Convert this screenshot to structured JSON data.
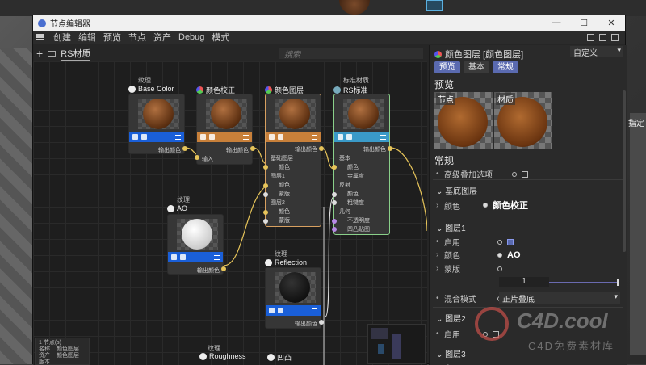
{
  "window": {
    "title": "节点编辑器",
    "controls": [
      "—",
      "☐",
      "✕"
    ]
  },
  "menu": [
    "创建",
    "编辑",
    "预览",
    "节点",
    "资产",
    "Debug",
    "模式"
  ],
  "editor": {
    "tab": "RS材质",
    "search_placeholder": "搜索"
  },
  "nodes": {
    "base_color": {
      "group": "纹理",
      "title": "Base Color",
      "port_out": "输出颜色"
    },
    "color_correct": {
      "title": "颜色校正",
      "port_in": "输入",
      "port_out": "输出颜色"
    },
    "color_layer": {
      "title": "颜色图层",
      "port_out": "输出颜色",
      "ports": [
        "基础图层",
        "颜色",
        "图层1",
        "颜色",
        "蒙版",
        "图层2",
        "颜色",
        "蒙版"
      ]
    },
    "rs_standard": {
      "group": "标准材质",
      "title": "RS标准",
      "port_out": "输出颜色",
      "ports": [
        "基本",
        "颜色",
        "金属度",
        "反射",
        "颜色",
        "粗糙度",
        "几何",
        "不透明度",
        "凹凸贴图"
      ]
    },
    "ao": {
      "group": "纹理",
      "title": "AO",
      "port_out": "输出颜色"
    },
    "reflection": {
      "group": "纹理",
      "title": "Reflection",
      "port_out": "输出颜色"
    },
    "roughness": {
      "group": "纹理",
      "title": "Roughness"
    },
    "bump": {
      "title": "凹凸"
    }
  },
  "info": {
    "count": "1 节点(s)",
    "rows": [
      [
        "名称",
        "颜色图层"
      ],
      [
        "资产",
        "颜色图层"
      ],
      [
        "版本",
        ""
      ]
    ]
  },
  "panel": {
    "header": "颜色图层 [颜色图层]",
    "mode": "自定义",
    "tabs": [
      "预览",
      "基本",
      "常规"
    ],
    "preview_title": "预览",
    "previews": [
      "节点",
      "材质"
    ],
    "general_title": "常规",
    "advanced": "高级叠加选项",
    "base_layer": "基底图层",
    "base_color_label": "颜色",
    "base_color_value": "颜色校正",
    "layer1": "图层1",
    "enable": "启用",
    "color": "颜色",
    "layer1_color_value": "AO",
    "mask": "蒙版",
    "mask_value": "1",
    "blend_mode": "混合模式",
    "blend_value": "正片叠底",
    "layer2": "图层2",
    "layer3": "图层3"
  },
  "background": {
    "side_label": "指定"
  },
  "watermark": {
    "brand": "C4D.cool",
    "sub": "C4D免费素材库"
  },
  "colors": {
    "accent": "#5a6ab0",
    "bar_blue": "#1a5fd8",
    "bar_orange": "#c8803a",
    "bar_teal": "#3a9ac8",
    "wire": "#e6c45a"
  }
}
